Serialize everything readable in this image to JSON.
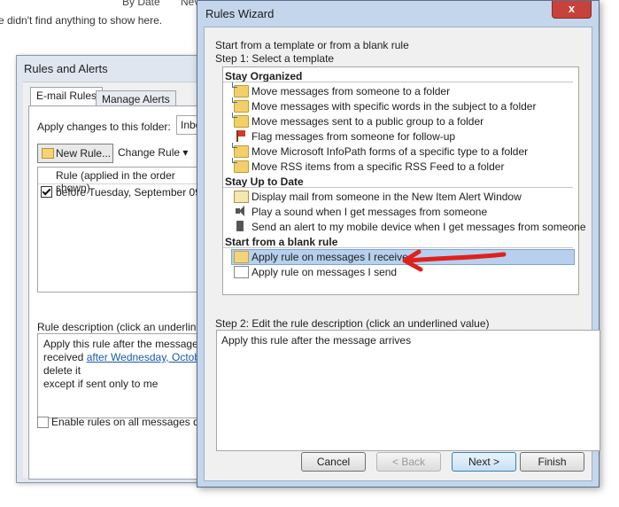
{
  "background": {
    "sort_label": "By Date",
    "newest_label": "Nev",
    "empty_message": "e didn't find anything to show here."
  },
  "rules_alerts": {
    "title": "Rules and Alerts",
    "tabs": [
      "E-mail Rules",
      "Manage Alerts"
    ],
    "apply_label": "Apply changes to this folder:",
    "folder_value": "Inbo",
    "new_rule_label": "New Rule...",
    "change_rule_label": "Change Rule ▾",
    "column_header": "Rule (applied in the order shown)",
    "rule_row": "before Tuesday, September 09,",
    "rule_checked": true,
    "desc_label": "Rule description (click an underline",
    "desc_lines": {
      "l1": "Apply this rule after the message a",
      "l2_prefix": "received ",
      "l2_link": "after Wednesday, Octobe",
      "l3": "delete it",
      "l4": "except if sent only to me"
    },
    "enable_label": "Enable rules on all messages do"
  },
  "wizard": {
    "title": "Rules Wizard",
    "close_glyph": "x",
    "start_label": "Start from a template or from a blank rule",
    "step1_label": "Step 1: Select a template",
    "groups": {
      "organized": "Stay Organized",
      "uptodate": "Stay Up to Date",
      "blank": "Start from a blank rule"
    },
    "items": [
      {
        "label": "Move messages from someone to a folder",
        "icon": "folder-icon"
      },
      {
        "label": "Move messages with specific words in the subject to a folder",
        "icon": "folder-icon"
      },
      {
        "label": "Move messages sent to a public group to a folder",
        "icon": "folder-icon"
      },
      {
        "label": "Flag messages from someone for follow-up",
        "icon": "flag-icon"
      },
      {
        "label": "Move Microsoft InfoPath forms of a specific type to a folder",
        "icon": "folder-icon"
      },
      {
        "label": "Move RSS items from a specific RSS Feed to a folder",
        "icon": "folder-icon"
      },
      {
        "label": "Display mail from someone in the New Item Alert Window",
        "icon": "alert-window-icon"
      },
      {
        "label": "Play a sound when I get messages from someone",
        "icon": "speaker-icon"
      },
      {
        "label": "Send an alert to my mobile device when I get messages from someone",
        "icon": "phone-icon"
      },
      {
        "label": "Apply rule on messages I receive",
        "icon": "receive-envelope-icon",
        "selected": true
      },
      {
        "label": "Apply rule on messages I send",
        "icon": "send-envelope-icon"
      }
    ],
    "step2_label": "Step 2: Edit the rule description (click an underlined value)",
    "step2_text": "Apply this rule after the message arrives",
    "buttons": {
      "cancel": "Cancel",
      "back": "< Back",
      "next": "Next >",
      "finish": "Finish"
    },
    "annotation_color": "#e0201c"
  }
}
